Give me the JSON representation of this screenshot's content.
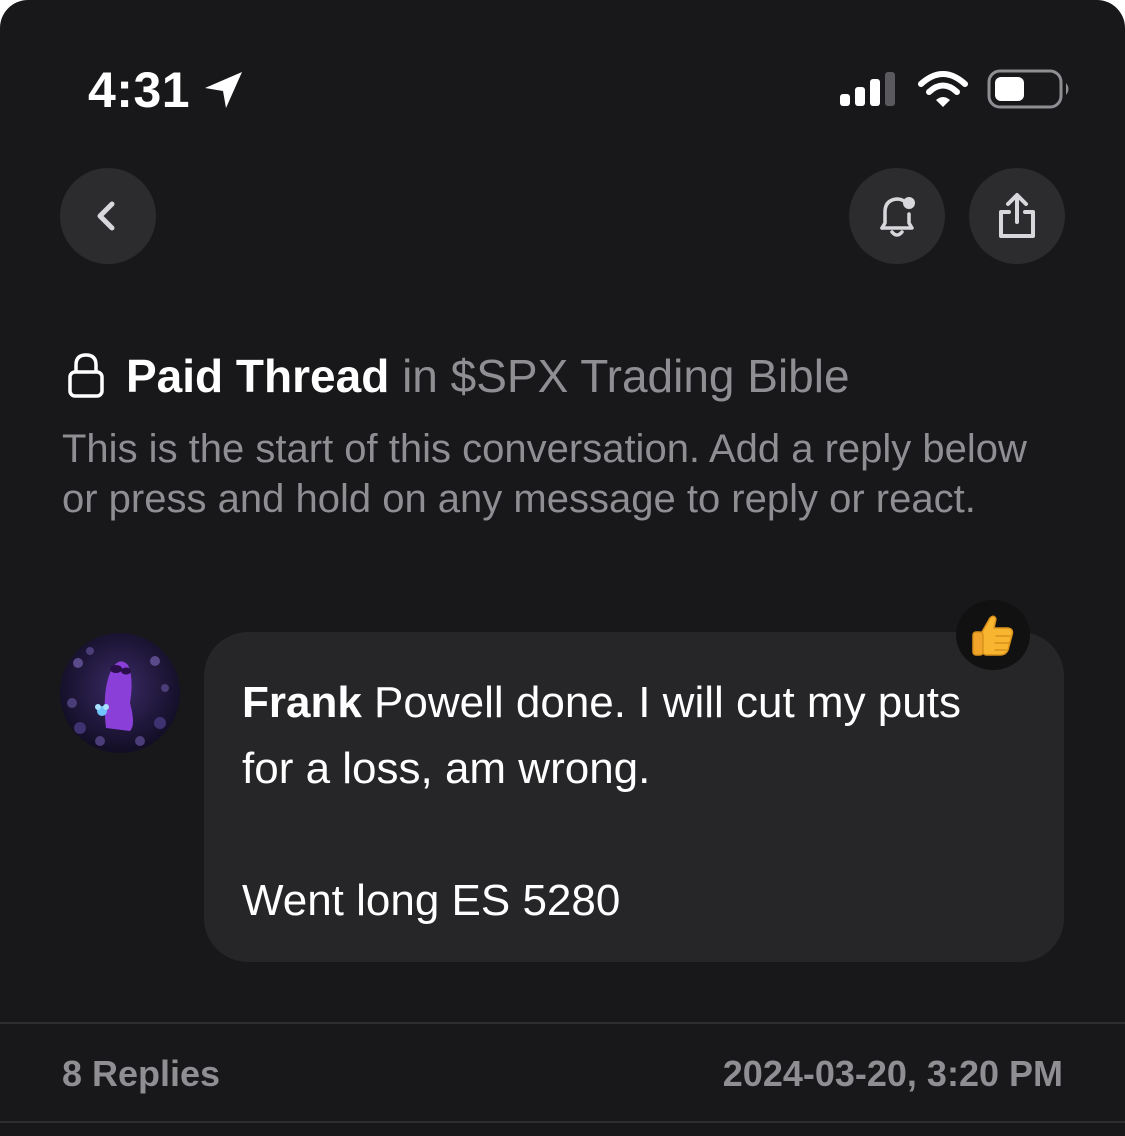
{
  "status_bar": {
    "time": "4:31",
    "icons": [
      "location-arrow-icon",
      "cellular-signal-icon",
      "wifi-icon",
      "battery-icon"
    ]
  },
  "nav": {
    "icons": [
      "chevron-left-icon",
      "bell-icon",
      "share-icon"
    ]
  },
  "thread": {
    "lock_icon": "lock-icon",
    "title": "Paid Thread",
    "in_text": "in $SPX Trading Bible",
    "intro": "This is the start of this conversation. Add a reply below or press and hold on any message to reply or react."
  },
  "message": {
    "author": "Frank",
    "text": " Powell done. I will cut my puts for a loss, am wrong.\n\nWent long ES 5280",
    "reaction": "👍"
  },
  "footer": {
    "replies": "8 Replies",
    "timestamp": "2024-03-20, 3:20 PM"
  },
  "colors": {
    "background": "#18181a",
    "bubble": "#262628",
    "button": "#2c2c2e",
    "muted_text": "#8e8e93",
    "avatar_purple": "#8b3fd9"
  }
}
